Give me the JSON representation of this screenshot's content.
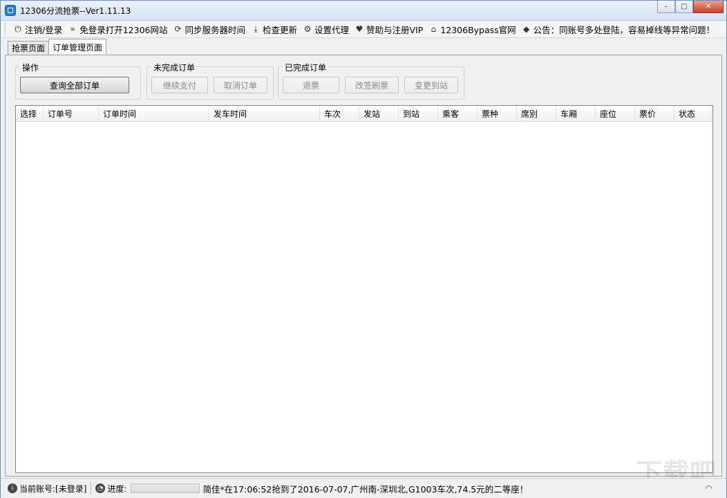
{
  "window": {
    "title": "12306分流抢票--Ver1.11.13",
    "minimize": "–",
    "maximize": "□",
    "close": "✕"
  },
  "toolbar": {
    "items": [
      {
        "label": "注销/登录",
        "icon": "power-icon"
      },
      {
        "label": "免登录打开12306网站",
        "icon": "double-chevron-icon"
      },
      {
        "label": "同步服务器时间",
        "icon": "sync-icon"
      },
      {
        "label": "检查更新",
        "icon": "download-icon"
      },
      {
        "label": "设置代理",
        "icon": "gear-icon"
      },
      {
        "label": "赞助与注册VIP",
        "icon": "heart-icon"
      },
      {
        "label": "12306Bypass官网",
        "icon": "home-icon"
      },
      {
        "label": "公告：同账号多处登陆，容易掉线等异常问题！",
        "icon": "tag-icon"
      }
    ]
  },
  "tabs": [
    {
      "label": "抢票页面",
      "active": false
    },
    {
      "label": "订单管理页面",
      "active": true
    }
  ],
  "groups": {
    "operations": {
      "label": "操作",
      "query_all": "查询全部订单"
    },
    "incomplete": {
      "label": "未完成订单",
      "continue_pay": "继续支付",
      "cancel_order": "取消订单"
    },
    "completed": {
      "label": "已完成订单",
      "refund": "退票",
      "reschedule": "改签刷票",
      "change_station": "变更到站"
    }
  },
  "table": {
    "columns": [
      "选择",
      "订单号",
      "订单时间",
      "发车时间",
      "车次",
      "发站",
      "到站",
      "乘客",
      "票种",
      "席别",
      "车厢",
      "座位",
      "票价",
      "状态"
    ],
    "rows": []
  },
  "status": {
    "account": "当前账号:[未登录]",
    "progress_label": "进度:",
    "progress": 0,
    "message": "简佳*在17:06:52抢到了2016-07-07,广州南-深圳北,G1003车次,74.5元的二等座！"
  },
  "watermark": {
    "text": "下载吧"
  },
  "colors": {
    "title_bar": "#d7e4f5",
    "close_button": "#c7432b",
    "progress_fill": "#4fb83a"
  }
}
